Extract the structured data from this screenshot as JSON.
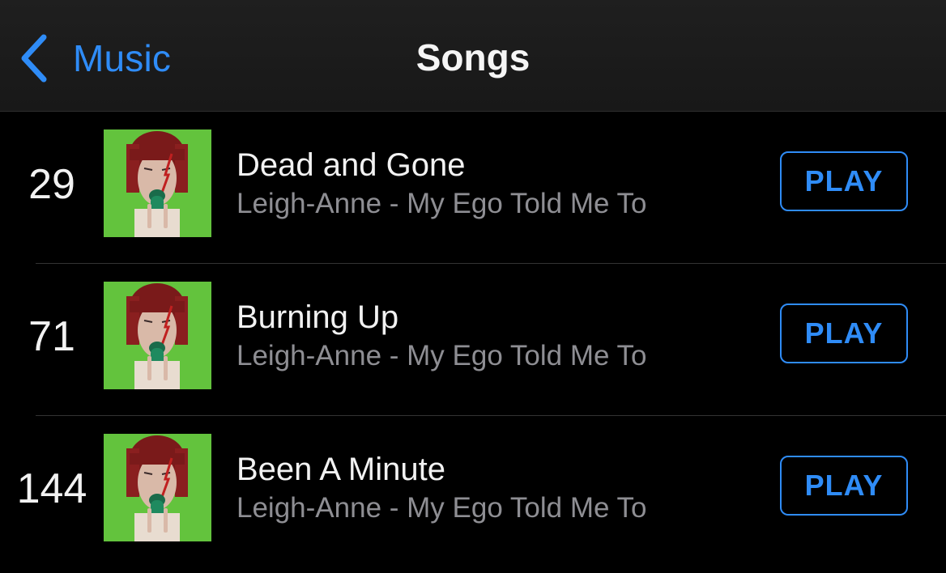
{
  "nav": {
    "back_label": "Music",
    "title": "Songs"
  },
  "songs": [
    {
      "rank": "29",
      "title": "Dead and Gone",
      "subtitle": "Leigh-Anne - My Ego Told Me To",
      "action": "PLAY"
    },
    {
      "rank": "71",
      "title": "Burning Up",
      "subtitle": "Leigh-Anne - My Ego Told Me To",
      "action": "PLAY"
    },
    {
      "rank": "144",
      "title": "Been A Minute",
      "subtitle": "Leigh-Anne - My Ego Told Me To",
      "action": "PLAY"
    }
  ],
  "colors": {
    "accent": "#2f8cf7",
    "background": "#000000",
    "nav_background": "#1c1c1c",
    "primary_text": "#f2f2f2",
    "secondary_text": "#8e8e93",
    "artwork_green": "#5fbf3a"
  },
  "icons": {
    "back": "chevron-left-icon",
    "artwork": "album-artwork"
  }
}
